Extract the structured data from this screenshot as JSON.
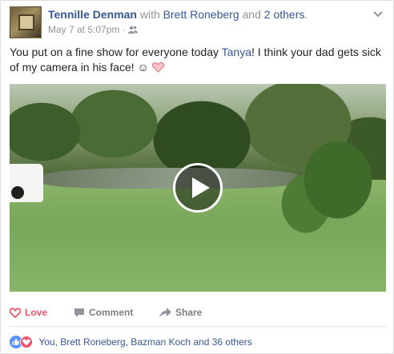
{
  "post": {
    "author": "Tennille Denman",
    "with_text": "with",
    "tagged_person": "Brett Roneberg",
    "and_text": "and",
    "others_link": "2 others",
    "period": ".",
    "timestamp": "May 7 at 5:07pm",
    "separator": "·",
    "audience_icon": "friends-icon",
    "menu_icon": "chevron-down-icon"
  },
  "message": {
    "before_mention": "You put on a fine show for everyone today ",
    "mention": "Tanya",
    "after_mention": "! I think your dad gets sick of my camera in his face! ☺",
    "emoji_icon": "heart-icon"
  },
  "video": {
    "play_icon": "play-icon"
  },
  "actions": {
    "love_label": "Love",
    "comment_label": "Comment",
    "share_label": "Share"
  },
  "reactions": {
    "summary": "You, Brett Roneberg, Bazman Koch and 36 others",
    "icons": [
      "like-reaction-icon",
      "love-reaction-icon"
    ]
  },
  "colors": {
    "link": "#365899",
    "love": "#f25268",
    "like": "#5890ff",
    "meta": "#90949c"
  }
}
